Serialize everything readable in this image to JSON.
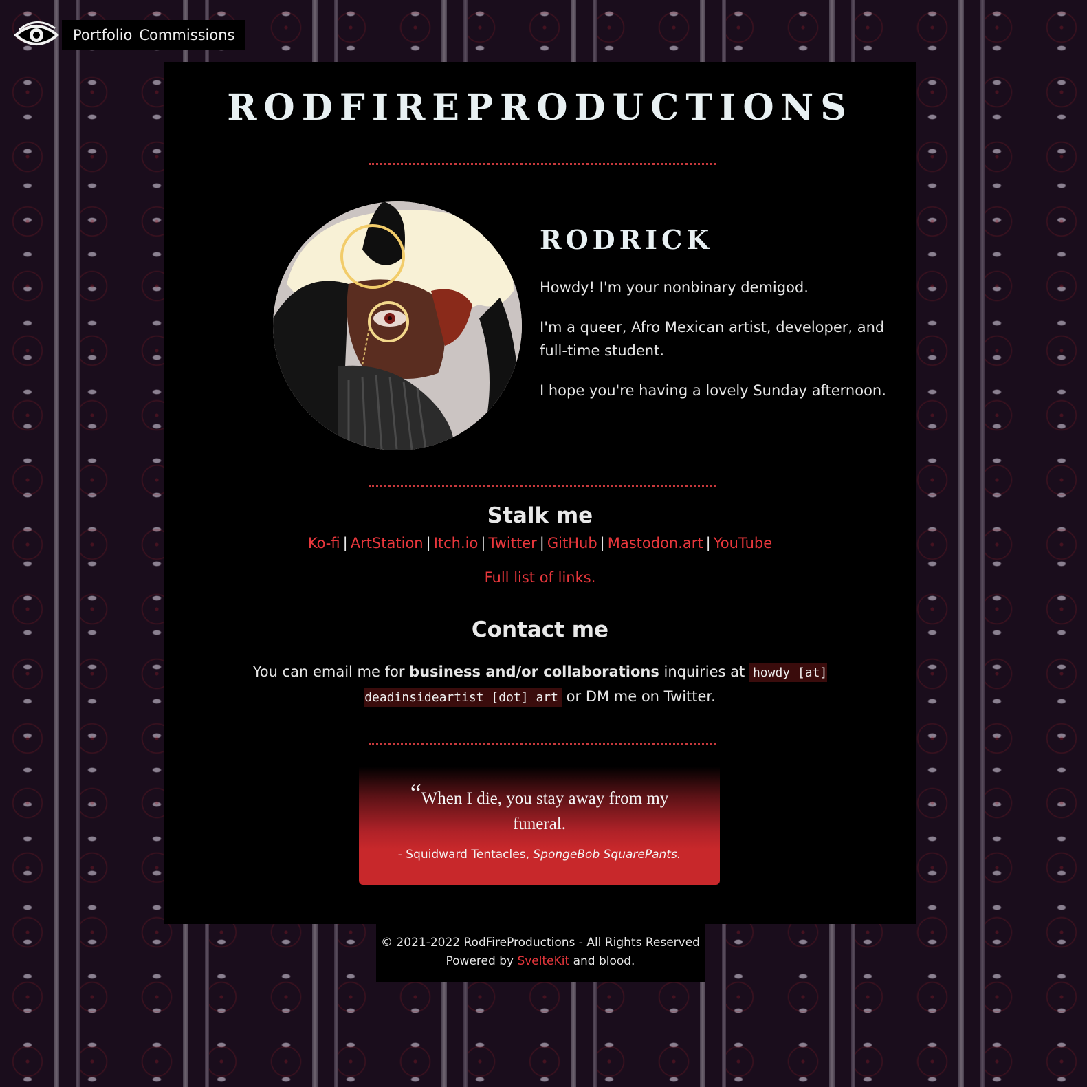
{
  "nav": {
    "logo_icon": "eye-icon",
    "items": [
      {
        "label": "Portfolio"
      },
      {
        "label": "Commissions"
      }
    ]
  },
  "header": {
    "title": "RodFireProductions"
  },
  "bio": {
    "name": "Rodrick",
    "avatar_alt": "avatar-illustration",
    "paragraphs": [
      "Howdy! I'm your nonbinary demigod.",
      "I'm a queer, Afro Mexican artist, developer, and full-time student.",
      "I hope you're having a lovely Sunday afternoon."
    ]
  },
  "social": {
    "heading": "Stalk me",
    "links": [
      {
        "label": "Ko-fi"
      },
      {
        "label": "ArtStation"
      },
      {
        "label": "Itch.io"
      },
      {
        "label": "Twitter"
      },
      {
        "label": "GitHub"
      },
      {
        "label": "Mastodon.art"
      },
      {
        "label": "YouTube"
      }
    ],
    "separator": "|",
    "full_list_label": "Full list of links."
  },
  "contact": {
    "heading": "Contact me",
    "text_before": "You can email me for",
    "bold": "business and/or collaborations",
    "text_middle": "inquiries at",
    "email_code": "howdy [at] deadinsideartist [dot] art",
    "text_after": "or DM me on Twitter."
  },
  "quote": {
    "open_mark": "“",
    "text": "When I die, you stay away from my funeral.",
    "attribution_prefix": "- Squidward Tentacles,",
    "attribution_work": "SpongeBob SquarePants."
  },
  "footer": {
    "copyright": "© 2021-2022 RodFireProductions - All Rights Reserved",
    "powered_prefix": "Powered by",
    "powered_link": "SvelteKit",
    "powered_suffix": "and blood."
  },
  "colors": {
    "accent": "#e8373c",
    "background": "#000000",
    "text": "#e6e6e6",
    "quote_red": "#c8282b"
  }
}
